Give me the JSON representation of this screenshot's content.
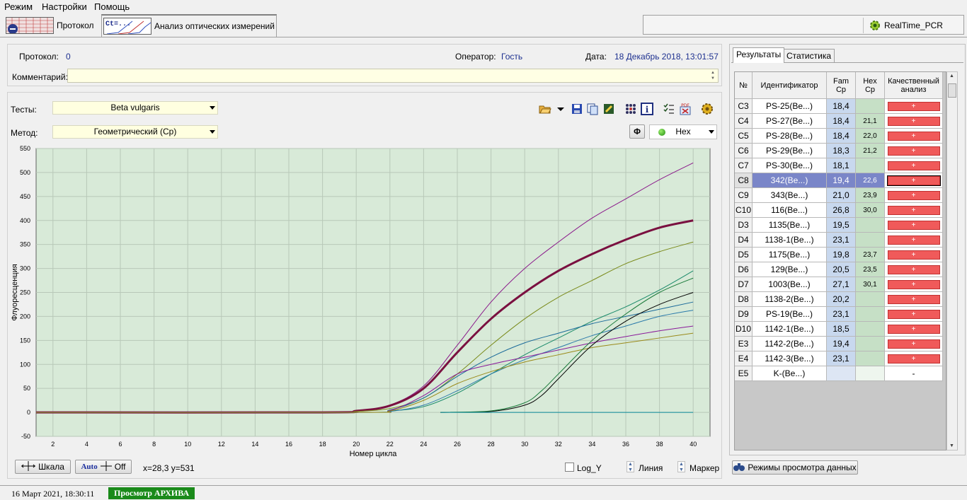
{
  "menu": [
    "Режим",
    "Настройки",
    "Помощь"
  ],
  "toolbar": {
    "tab_protocol": "Протокол",
    "tab_analysis": "Анализ оптических измерений",
    "realtime_pcr": "RealTime_PCR"
  },
  "info": {
    "protocol_label": "Протокол:",
    "protocol_value": "0",
    "operator_label": "Оператор:",
    "operator_value": "Гость",
    "date_label": "Дата:",
    "date_value": "18 Декабрь 2018, 13:01:57",
    "comment_label": "Комментарий:",
    "comment_value": ""
  },
  "controls": {
    "tests_label": "Тесты:",
    "tests_value": "Beta vulgaris",
    "method_label": "Метод:",
    "method_value": "Геометрический (Cp)",
    "channel_value": "Hex",
    "channel_button": "Φ"
  },
  "bottom": {
    "scale_button": "Шкала",
    "auto_label": "Auto",
    "off_label": "Off",
    "coords": "x=28,3 y=531",
    "log_y": "Log_Y",
    "line_label": "Линия",
    "marker_label": "Маркер"
  },
  "chart_data": {
    "type": "line",
    "title": "",
    "xlabel": "Номер цикла",
    "ylabel": "Флуоресценция",
    "xlim": [
      1,
      41
    ],
    "ylim": [
      -50,
      550
    ],
    "xticks": [
      2,
      4,
      6,
      8,
      10,
      12,
      14,
      16,
      18,
      20,
      22,
      24,
      26,
      28,
      30,
      32,
      34,
      36,
      38,
      40
    ],
    "yticks": [
      -50,
      0,
      50,
      100,
      150,
      200,
      250,
      300,
      350,
      400,
      450,
      500,
      550
    ],
    "grid": true,
    "background": "#d8ead8",
    "series": [
      {
        "color": "#8b1a8b",
        "width": 1,
        "x": [
          1,
          18,
          20,
          22,
          24,
          26,
          28,
          30,
          32,
          34,
          36,
          38,
          40
        ],
        "values": [
          0,
          0,
          3,
          15,
          55,
          140,
          230,
          300,
          355,
          405,
          445,
          485,
          520
        ]
      },
      {
        "color": "#7a1040",
        "width": 3,
        "x": [
          1,
          18,
          20,
          22,
          24,
          26,
          28,
          30,
          32,
          34,
          36,
          38,
          40
        ],
        "values": [
          0,
          0,
          3,
          14,
          50,
          125,
          195,
          250,
          295,
          330,
          360,
          385,
          400
        ]
      },
      {
        "color": "#7a8a1a",
        "width": 1,
        "x": [
          1,
          18,
          20,
          22,
          24,
          26,
          28,
          30,
          32,
          34,
          36,
          38,
          40
        ],
        "values": [
          0,
          0,
          2,
          8,
          30,
          80,
          140,
          195,
          240,
          275,
          310,
          335,
          355
        ]
      },
      {
        "color": "#1a8a6a",
        "width": 1,
        "x": [
          1,
          20,
          22,
          24,
          26,
          28,
          30,
          32,
          34,
          36,
          38,
          40
        ],
        "values": [
          0,
          0,
          3,
          12,
          40,
          80,
          120,
          155,
          190,
          220,
          255,
          295
        ]
      },
      {
        "color": "#1a6a9a",
        "width": 1,
        "x": [
          1,
          20,
          22,
          24,
          26,
          28,
          30,
          32,
          34,
          36,
          38,
          40
        ],
        "values": [
          0,
          0,
          5,
          30,
          75,
          115,
          145,
          165,
          185,
          200,
          215,
          230
        ]
      },
      {
        "color": "#2a7aaa",
        "width": 1,
        "x": [
          1,
          20,
          22,
          24,
          26,
          28,
          30,
          32,
          34,
          36,
          38,
          40
        ],
        "values": [
          0,
          0,
          2,
          15,
          45,
          80,
          110,
          135,
          160,
          180,
          200,
          213
        ]
      },
      {
        "color": "#8a1a9a",
        "width": 1,
        "x": [
          1,
          20,
          22,
          24,
          26,
          28,
          30,
          32,
          34,
          36,
          38,
          40
        ],
        "values": [
          0,
          0,
          4,
          35,
          80,
          100,
          115,
          130,
          145,
          158,
          170,
          180
        ]
      },
      {
        "color": "#9a8a1a",
        "width": 1,
        "x": [
          1,
          20,
          22,
          24,
          26,
          28,
          30,
          32,
          34,
          36,
          38,
          40
        ],
        "values": [
          0,
          0,
          3,
          25,
          60,
          85,
          105,
          120,
          135,
          145,
          155,
          165
        ]
      },
      {
        "color": "#000000",
        "width": 1,
        "x": [
          25,
          28,
          30,
          31,
          32,
          34,
          36,
          38,
          40
        ],
        "values": [
          0,
          2,
          15,
          35,
          70,
          140,
          190,
          225,
          250
        ]
      },
      {
        "color": "#1a7a3a",
        "width": 1,
        "x": [
          25,
          28,
          30,
          31,
          32,
          34,
          36,
          38,
          40
        ],
        "values": [
          0,
          3,
          20,
          45,
          80,
          150,
          205,
          250,
          280
        ]
      },
      {
        "color": "#0a8a9a",
        "width": 1,
        "x": [
          25,
          40
        ],
        "values": [
          0,
          0
        ]
      }
    ]
  },
  "results": {
    "tab_results": "Результаты",
    "tab_stats": "Статистика",
    "headers": {
      "no": "№",
      "id": "Идентификатор",
      "fam1": "Fam",
      "fam2": "Cp",
      "hex1": "Hex",
      "hex2": "Cp",
      "q1": "Качественный",
      "q2": "анализ"
    },
    "rows": [
      {
        "no": "C3",
        "id": "PS-25(Be...)",
        "fam": "18,4",
        "hex": "",
        "q": "+"
      },
      {
        "no": "C4",
        "id": "PS-27(Be...)",
        "fam": "18,4",
        "hex": "21,1",
        "q": "+"
      },
      {
        "no": "C5",
        "id": "PS-28(Be...)",
        "fam": "18,4",
        "hex": "22,0",
        "q": "+"
      },
      {
        "no": "C6",
        "id": "PS-29(Be...)",
        "fam": "18,3",
        "hex": "21,2",
        "q": "+"
      },
      {
        "no": "C7",
        "id": "PS-30(Be...)",
        "fam": "18,1",
        "hex": "",
        "q": "+"
      },
      {
        "no": "C8",
        "id": "342(Be...)",
        "fam": "19,4",
        "hex": "22,6",
        "q": "+",
        "selected": true
      },
      {
        "no": "C9",
        "id": "343(Be...)",
        "fam": "21,0",
        "hex": "23,9",
        "q": "+"
      },
      {
        "no": "C10",
        "id": "116(Be...)",
        "fam": "26,8",
        "hex": "30,0",
        "q": "+"
      },
      {
        "no": "D3",
        "id": "1135(Be...)",
        "fam": "19,5",
        "hex": "",
        "q": "+"
      },
      {
        "no": "D4",
        "id": "1138-1(Be...)",
        "fam": "23,1",
        "hex": "",
        "q": "+"
      },
      {
        "no": "D5",
        "id": "1175(Be...)",
        "fam": "19,8",
        "hex": "23,7",
        "q": "+"
      },
      {
        "no": "D6",
        "id": "129(Be...)",
        "fam": "20,5",
        "hex": "23,5",
        "q": "+"
      },
      {
        "no": "D7",
        "id": "1003(Be...)",
        "fam": "27,1",
        "hex": "30,1",
        "q": "+"
      },
      {
        "no": "D8",
        "id": "1138-2(Be...)",
        "fam": "20,2",
        "hex": "",
        "q": "+"
      },
      {
        "no": "D9",
        "id": "PS-19(Be...)",
        "fam": "23,1",
        "hex": "",
        "q": "+"
      },
      {
        "no": "D10",
        "id": "1142-1(Be...)",
        "fam": "18,5",
        "hex": "",
        "q": "+"
      },
      {
        "no": "E3",
        "id": "1142-2(Be...)",
        "fam": "19,4",
        "hex": "",
        "q": "+"
      },
      {
        "no": "E4",
        "id": "1142-3(Be...)",
        "fam": "23,1",
        "hex": "",
        "q": "+"
      },
      {
        "no": "E5",
        "id": "K-(Be...)",
        "fam": "",
        "hex": "",
        "q": "-"
      }
    ],
    "view_modes_button": "Режимы просмотра данных"
  },
  "status": {
    "datetime": "16 Март 2021, 18:30:11",
    "mode": "Просмотр АРХИВА"
  }
}
